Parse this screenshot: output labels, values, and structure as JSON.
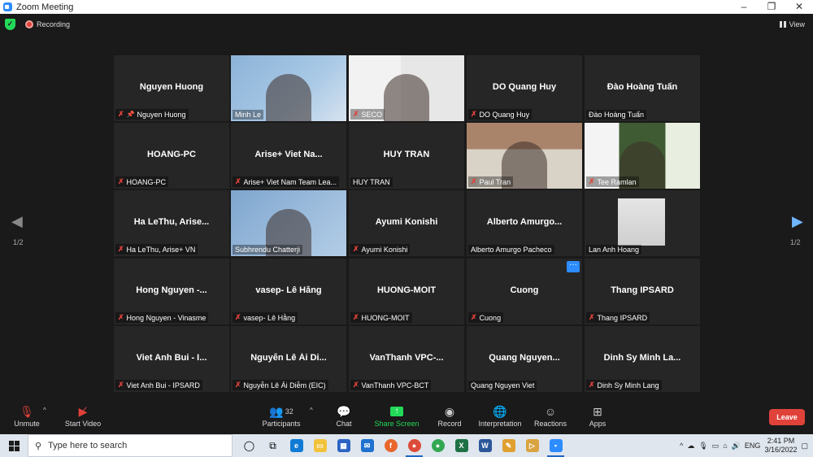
{
  "window": {
    "title": "Zoom Meeting",
    "controls": [
      "–",
      "❐",
      "✕"
    ]
  },
  "header": {
    "recording_label": "Recording",
    "view_label": "View"
  },
  "pagination": {
    "left": "1/2",
    "right": "1/2"
  },
  "tiles": [
    {
      "big": "Nguyen Huong",
      "label": "Nguyen Huong",
      "muted": true,
      "pinned": true
    },
    {
      "big": "",
      "label": "Minh Le",
      "muted": false
    },
    {
      "big": "",
      "label": "SECO",
      "muted": true
    },
    {
      "big": "DO Quang Huy",
      "label": "DO Quang Huy",
      "muted": true
    },
    {
      "big": "Đào Hoàng Tuấn",
      "label": "Đào Hoàng Tuấn",
      "muted": false
    },
    {
      "big": "HOANG-PC",
      "label": "HOANG-PC",
      "muted": true
    },
    {
      "big": "Arise+ Viet Na...",
      "label": "Arise+ Viet Nam Team Lea...",
      "muted": true
    },
    {
      "big": "HUY TRAN",
      "label": "HUY TRAN",
      "muted": false
    },
    {
      "big": "",
      "label": "Paul Tran",
      "muted": true
    },
    {
      "big": "",
      "label": "Tee Ramlan",
      "muted": true
    },
    {
      "big": "Ha LeThu, Arise...",
      "label": "Ha LeThu, Arise+ VN",
      "muted": true
    },
    {
      "big": "",
      "label": "Subhrendu Chatterji",
      "muted": false
    },
    {
      "big": "Ayumi Konishi",
      "label": "Ayumi Konishi",
      "muted": true
    },
    {
      "big": "Alberto  Amurgo...",
      "label": "Alberto Amurgo Pacheco",
      "muted": false
    },
    {
      "big": "",
      "label": "Lan Anh Hoang",
      "muted": false
    },
    {
      "big": "Hong Nguyen -...",
      "label": "Hong Nguyen - Vinasme",
      "muted": true
    },
    {
      "big": "vasep- Lê Hằng",
      "label": "vasep- Lê Hằng",
      "muted": true
    },
    {
      "big": "HUONG-MOIT",
      "label": "HUONG-MOIT",
      "muted": true
    },
    {
      "big": "Cuong",
      "label": "Cuong",
      "muted": true
    },
    {
      "big": "Thang IPSARD",
      "label": "Thang IPSARD",
      "muted": true
    },
    {
      "big": "Viet Anh Bui - I...",
      "label": "Viet Anh Bui - IPSARD",
      "muted": true
    },
    {
      "big": "Nguyễn Lê Ái Di...",
      "label": "Nguyễn Lê Ái Diễm (EIC)",
      "muted": true
    },
    {
      "big": "VanThanh  VPC-...",
      "label": "VanThanh VPC-BCT",
      "muted": true
    },
    {
      "big": "Quang  Nguyen...",
      "label": "Quang Nguyen Viet",
      "muted": false
    },
    {
      "big": "Dinh Sy Minh La...",
      "label": "Dinh Sy Minh Lang",
      "muted": true
    }
  ],
  "toolbar": {
    "unmute": "Unmute",
    "start_video": "Start Video",
    "participants": "Participants",
    "participants_count": "32",
    "chat": "Chat",
    "share_screen": "Share Screen",
    "record": "Record",
    "interpretation": "Interpretation",
    "reactions": "Reactions",
    "apps": "Apps",
    "leave": "Leave"
  },
  "taskbar": {
    "search_placeholder": "Type here to search",
    "time": "2:41 PM",
    "date": "3/16/2022",
    "lang": "ENG"
  },
  "colors": {
    "accent": "#2d8cff",
    "leave": "#e0423a",
    "share": "#23d959",
    "active_speaker": "#c8e364"
  }
}
